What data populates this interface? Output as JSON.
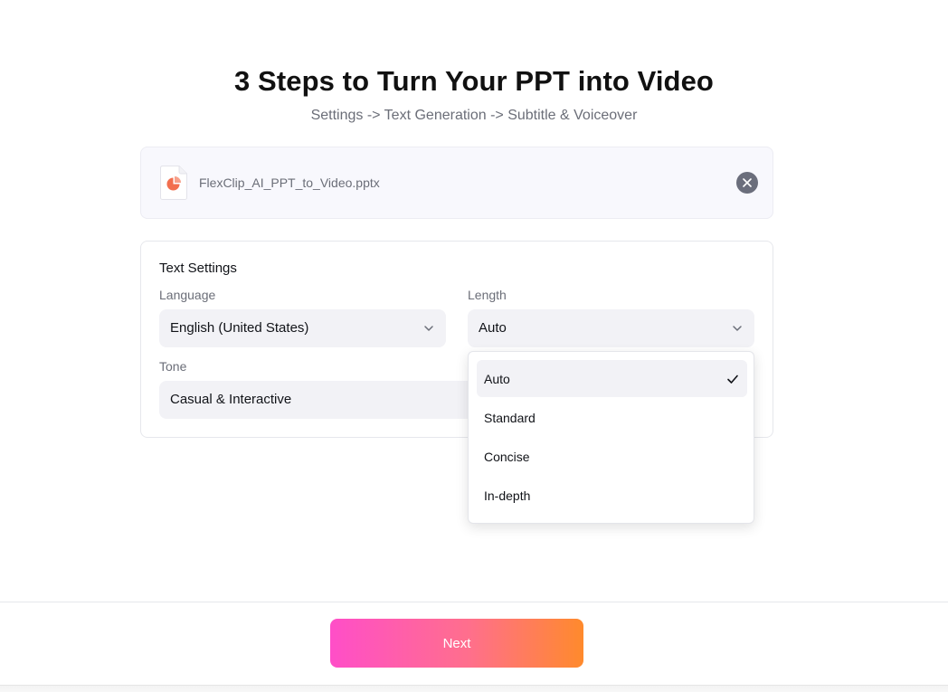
{
  "header": {
    "title": "3 Steps to Turn Your PPT into Video",
    "subtitle": "Settings -> Text Generation -> Subtitle & Voiceover"
  },
  "file": {
    "name": "FlexClip_AI_PPT_to_Video.pptx",
    "icon": "ppt-file-icon",
    "remove_icon": "close-icon"
  },
  "text_settings": {
    "section_title": "Text Settings",
    "language": {
      "label": "Language",
      "value": "English (United States)"
    },
    "length": {
      "label": "Length",
      "value": "Auto"
    },
    "tone": {
      "label": "Tone",
      "value": "Casual & Interactive"
    }
  },
  "length_dropdown": {
    "options": [
      {
        "label": "Auto",
        "selected": true
      },
      {
        "label": "Standard",
        "selected": false
      },
      {
        "label": "Concise",
        "selected": false
      },
      {
        "label": "In-depth",
        "selected": false
      }
    ]
  },
  "footer": {
    "next_label": "Next"
  },
  "colors": {
    "accent_gradient_start": "#ff4ec8",
    "accent_gradient_end": "#ff8a2c",
    "ppt_icon": "#f26f4f"
  }
}
